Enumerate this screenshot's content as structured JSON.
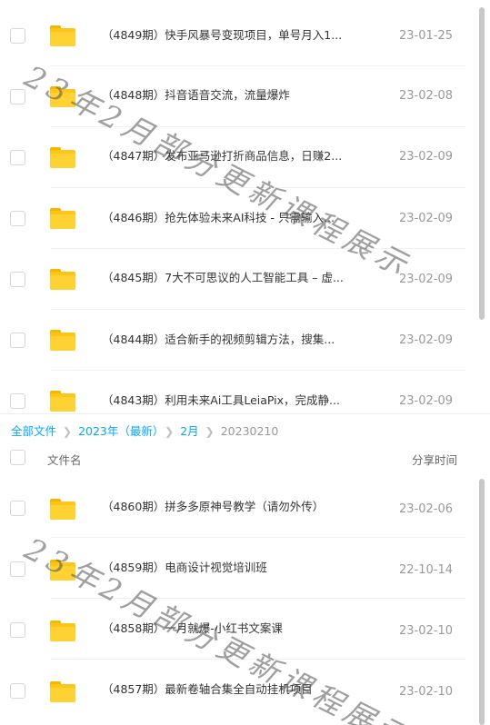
{
  "top_list": {
    "rows": [
      {
        "name": "（4849期）快手风暴号变现项目，单号月入1...",
        "date": "23-01-25"
      },
      {
        "name": "（4848期）抖音语音交流，流量爆炸",
        "date": "23-02-08"
      },
      {
        "name": "（4847期）发布亚马逊打折商品信息，日赚2...",
        "date": "23-02-09"
      },
      {
        "name": "（4846期）抢先体验未来AI科技 - 只需输入...",
        "date": "23-02-09"
      },
      {
        "name": "（4845期）7大不可思议的人工智能工具 – 虚...",
        "date": "23-02-09"
      },
      {
        "name": "（4844期）适合新手的视频剪辑方法，搜集...",
        "date": "23-02-09"
      },
      {
        "name": "（4843期）利用未来Ai工具LeiaPix，完成静...",
        "date": "23-02-09"
      }
    ]
  },
  "breadcrumb": {
    "items": [
      "全部文件",
      "2023年（最新）",
      "2月"
    ],
    "current": "20230210"
  },
  "bottom_list": {
    "header": {
      "name": "文件名",
      "time": "分享时间"
    },
    "rows": [
      {
        "name": "（4860期）拼多多原神号教学（请勿外传）",
        "date": "23-02-06"
      },
      {
        "name": "（4859期）电商设计视觉培训班",
        "date": "22-10-14"
      },
      {
        "name": "（4858期）一月就爆-小红书文案课",
        "date": "23-02-10"
      },
      {
        "name": "（4857期）最新卷轴合集全自动挂机项目",
        "date": "23-02-10"
      }
    ]
  },
  "watermark": {
    "text": "23年2月部分更新课程展示"
  },
  "icons": {
    "folder": "folder-icon",
    "chevron": "chevron-right-icon"
  },
  "colors": {
    "accent": "#06a7ff",
    "folder": "#ffd234",
    "muted": "#999999"
  }
}
